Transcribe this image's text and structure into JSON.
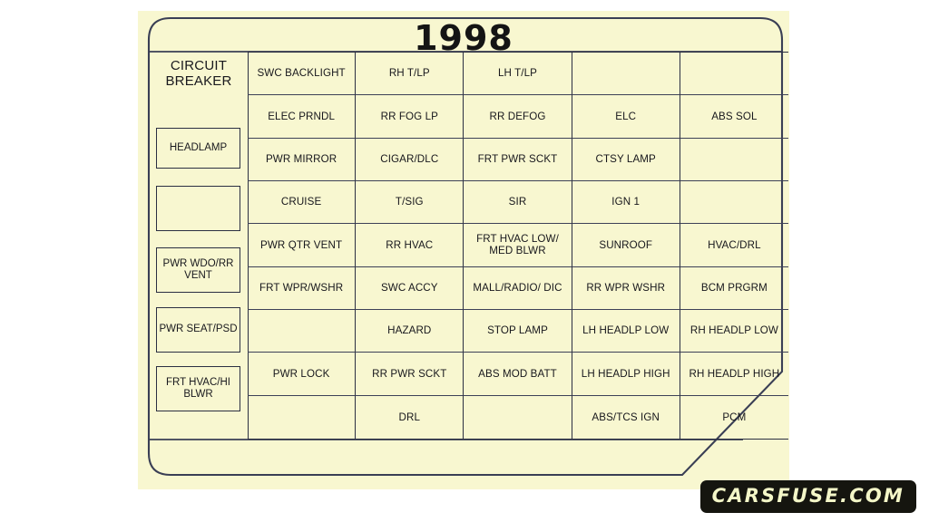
{
  "panel": {
    "title": "1998",
    "breaker_column": {
      "heading_line1": "CIRCUIT",
      "heading_line2": "BREAKER",
      "boxes": [
        {
          "label": "HEADLAMP"
        },
        {
          "label": ""
        },
        {
          "label": "PWR WDO/RR VENT"
        },
        {
          "label": "PWR SEAT/PSD"
        },
        {
          "label": "FRT HVAC/HI BLWR"
        }
      ]
    },
    "grid": {
      "columns": 5,
      "rows": 9,
      "cells": [
        [
          "SWC BACKLIGHT",
          "RH T/LP",
          "LH T/LP",
          "",
          ""
        ],
        [
          "ELEC PRNDL",
          "RR FOG LP",
          "RR DEFOG",
          "ELC",
          "ABS SOL"
        ],
        [
          "PWR MIRROR",
          "CIGAR/DLC",
          "FRT PWR SCKT",
          "CTSY LAMP",
          ""
        ],
        [
          "CRUISE",
          "T/SIG",
          "SIR",
          "IGN 1",
          ""
        ],
        [
          "PWR QTR VENT",
          "RR HVAC",
          "FRT HVAC LOW/ MED BLWR",
          "SUNROOF",
          "HVAC/DRL"
        ],
        [
          "FRT WPR/WSHR",
          "SWC ACCY",
          "MALL/RADIO/ DIC",
          "RR WPR WSHR",
          "BCM PRGRM"
        ],
        [
          "",
          "HAZARD",
          "STOP LAMP",
          "LH HEADLP LOW",
          "RH HEADLP LOW"
        ],
        [
          "PWR LOCK",
          "RR PWR SCKT",
          "ABS MOD BATT",
          "LH HEADLP HIGH",
          "RH HEADLP HIGH"
        ],
        [
          "",
          "DRL",
          "",
          "ABS/TCS IGN",
          "PCM"
        ]
      ]
    }
  },
  "watermark": {
    "text": "CARSFUSE.COM"
  },
  "colors": {
    "paper": "#f8f7d0",
    "ink": "#2b2f42",
    "text": "#17171c",
    "watermark_bg": "#15150f",
    "watermark_fg": "#f4f7c8"
  }
}
